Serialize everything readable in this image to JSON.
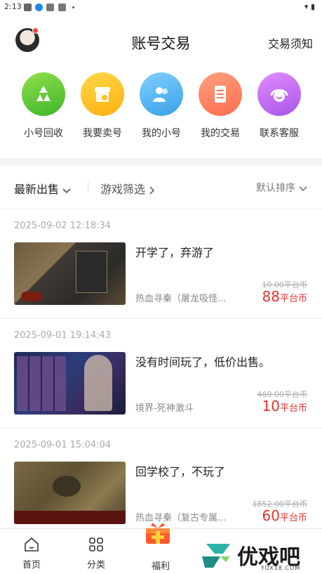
{
  "status_bar": {
    "time": "2:13"
  },
  "header": {
    "title": "账号交易",
    "notice": "交易须知"
  },
  "quick_nav": [
    {
      "label": "小号回收",
      "icon": "recycle-icon",
      "color": "#5fcb3a"
    },
    {
      "label": "我要卖号",
      "icon": "shop-icon",
      "color": "#ffc21f"
    },
    {
      "label": "我的小号",
      "icon": "users-icon",
      "color": "#4cb2f0"
    },
    {
      "label": "我的交易",
      "icon": "receipt-icon",
      "color": "#ff7a5a"
    },
    {
      "label": "联系客服",
      "icon": "headset-icon",
      "color": "#c46ff0"
    }
  ],
  "filters": {
    "latest": "最新出售",
    "game_filter": "游戏筛选",
    "sort": "默认排序"
  },
  "listings": [
    {
      "time": "2025-09-02 12:18:34",
      "title": "开学了，弃游了",
      "game": "热血寻秦（屠龙吸怪...",
      "original_price": "10.00平台币",
      "price": "88",
      "price_unit": "平台币"
    },
    {
      "time": "2025-09-01 19:14:43",
      "title": "没有时间玩了，低价出售。",
      "game": "境界-死神激斗",
      "original_price": "469.00平台币",
      "price": "10",
      "price_unit": "平台币"
    },
    {
      "time": "2025-09-01 15:04:04",
      "title": "回学校了，不玩了",
      "game": "热血寻秦（复古专属...",
      "original_price": "1852.00平台币",
      "price": "60",
      "price_unit": "平台币"
    }
  ],
  "tabs": [
    {
      "label": "首页",
      "icon": "home-icon"
    },
    {
      "label": "分类",
      "icon": "grid-icon"
    },
    {
      "label": "福利",
      "icon": "gift-icon"
    }
  ],
  "watermark": {
    "text": "优戏吧",
    "domain": "YOX18.COM"
  }
}
